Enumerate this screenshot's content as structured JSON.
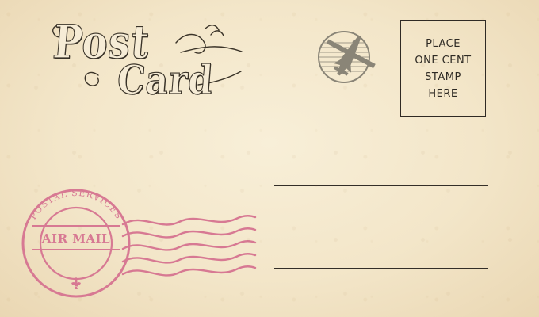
{
  "postcard": {
    "title_post": "Post",
    "title_card": "Card"
  },
  "stamp_box": {
    "line1": "PLACE",
    "line2": "ONE CENT",
    "line3": "STAMP",
    "line4": "HERE"
  },
  "postmark": {
    "top_text": "POSTAL SERVICES",
    "center_text": "AIR MAIL"
  },
  "colors": {
    "paper": "#f2e5c9",
    "ink": "#332e28",
    "postmark": "#d77993",
    "airplane": "#8a8577"
  },
  "icons": {
    "airplane_stamp": "airplane-stamp-icon",
    "fleur_de_lis": "fleur-de-lis-icon"
  }
}
